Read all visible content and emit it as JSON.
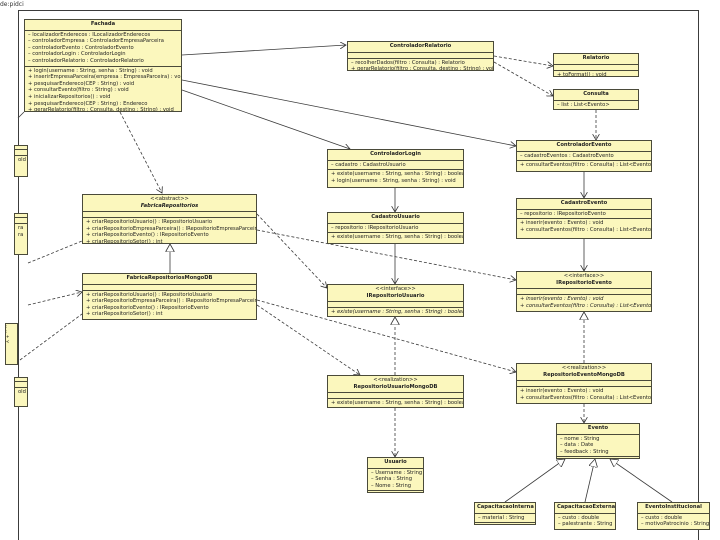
{
  "page_title": "de:pidci",
  "legend": [
    "",
    ":",
    ":",
    "+",
    "<"
  ],
  "classes": {
    "fachada": {
      "name": "Fachada",
      "attrs": [
        "– localizadorEnderecos : ILocalizadorEnderecos",
        "– controladorEmpresa : ControladorEmpresaParceira",
        "– controladorEvento : ControladorEvento",
        "– controladorLogin : ControladorLogin",
        "– controladorRelatorio : ControladorRelatorio"
      ],
      "ops": [
        "+ login(username : String, senha : String) : void",
        "+ inserirEmpresaParceira(empresa : EmpresaParceira) : void",
        "+ pesquisarEndereco(CEP : String) : void",
        "+ consultarEvento(filtro : String) : void",
        "+ inicializarRepositorios() : void",
        "+ pesquisarEndereco(CEP : String) : Endereco",
        "+ gerarRelatorio(filtro : Consulta, destino : String) : void"
      ]
    },
    "controladorRelatorio": {
      "name": "ControladorRelatorio",
      "attrs": [],
      "ops": [
        "– recolherDados(filtro : Consulta) : Relatorio",
        "+ gerarRelatorio(filtro : Consulta, destino : String) : void"
      ]
    },
    "relatorio": {
      "name": "Relatorio",
      "attrs": [],
      "ops": [
        "+ toFormat() : void"
      ]
    },
    "consulta": {
      "name": "Consulta",
      "attrs": [
        "– list : List<Evento>"
      ],
      "ops": []
    },
    "controladorEvento": {
      "name": "ControladorEvento",
      "attrs": [
        "– cadastroEventos : CadastroEvento"
      ],
      "ops": [
        "+ consultarEventos(filtro : Consulta) : List<Evento>"
      ]
    },
    "controladorLogin": {
      "name": "ControladorLogin",
      "attrs": [
        "– cadastro : CadastroUsuario"
      ],
      "ops": [
        "+ existe(username : String, senha : String) : boolean",
        "+ login(username : String, senha : String) : void"
      ]
    },
    "fabricaRepositorios": {
      "stereo": "<<abstract>>",
      "name": "FabricaRepositorios",
      "attrs": [],
      "ops": [
        "+ criarRepositorioUsuario() : IRepositorioUsuario",
        "+ criarRepositorioEmpresaParceira() : IRepositorioEmpresaParceira",
        "+ criarRepositorioEvento() : IRepositorioEvento",
        "+ criarRepositorioSetor() : int"
      ]
    },
    "cadastroUsuario": {
      "name": "CadastroUsuario",
      "attrs": [
        "– repositorio : IRepositorioUsuario"
      ],
      "ops": [
        "+ existe(username : String, senha : String) : boolean"
      ]
    },
    "cadastroEvento": {
      "name": "CadastroEvento",
      "attrs": [
        "– repositorio : IRepositorioEvento"
      ],
      "ops": [
        "+ inserir(evento : Evento) : void",
        "+ consultarEventos(filtro : Consulta) : List<Evento>"
      ]
    },
    "fabricaMongo": {
      "name": "FabricaRepositoriosMongoDB",
      "attrs": [],
      "ops": [
        "+ criarRepositorioUsuario() : IRepositorioUsuario",
        "+ criarRepositorioEmpresaParceira() : IRepositorioEmpresaParceira",
        "+ criarRepositorioEvento() : IRepositorioEvento",
        "+ criarRepositorioSetor() : int"
      ]
    },
    "iRepositorioUsuario": {
      "stereo": "<<interface>>",
      "name": "IRepositorioUsuario",
      "attrs": [],
      "ops": [
        "+ existe(username : String, senha : String) : boolean"
      ]
    },
    "iRepositorioEvento": {
      "stereo": "<<interface>>",
      "name": "IRepositorioEvento",
      "attrs": [],
      "ops": [
        "+ inserir(evento : Evento) : void",
        "+ consultarEventos(filtro : Consulta) : List<Evento>"
      ]
    },
    "repoEventoMongo": {
      "stereo": "<<realization>>",
      "name": "RepositorioEventoMongoDB",
      "attrs": [],
      "ops": [
        "+ inserir(evento : Evento) : void",
        "+ consultarEventos(filtro : Consulta) : List<Evento>"
      ]
    },
    "repoUsuarioMongo": {
      "stereo": "<<realization>>",
      "name": "RepositorioUsuarioMongoDB",
      "attrs": [],
      "ops": [
        "+ existe(username : String, senha : String) : boolean"
      ]
    },
    "evento": {
      "name": "Evento",
      "attrs": [
        "– nome : String",
        "– data : Date",
        "– feedback : String"
      ],
      "ops": []
    },
    "usuario": {
      "name": "Usuario",
      "attrs": [
        "– Username : String",
        "– Senha : String",
        "– Nome : String"
      ],
      "ops": []
    },
    "capInterna": {
      "name": "CapacitacaoInterna",
      "attrs": [
        "– material : String"
      ],
      "ops": []
    },
    "capExterna": {
      "name": "CapacitacaoExterna",
      "attrs": [
        "– custo : double",
        "– palestrante : String"
      ],
      "ops": []
    },
    "eventoInst": {
      "name": "EventoInstitucional",
      "attrs": [
        "– custo : double",
        "– motivoPatrocinio : String"
      ],
      "ops": []
    },
    "partial1": {
      "name": "",
      "attrs": [],
      "ops": [
        "old"
      ]
    },
    "partial2": {
      "name": "",
      "attrs": [],
      "ops": [
        "ra",
        "ra"
      ]
    },
    "partial3": {
      "name": "",
      "attrs": [],
      "ops": [
        "old"
      ]
    }
  }
}
